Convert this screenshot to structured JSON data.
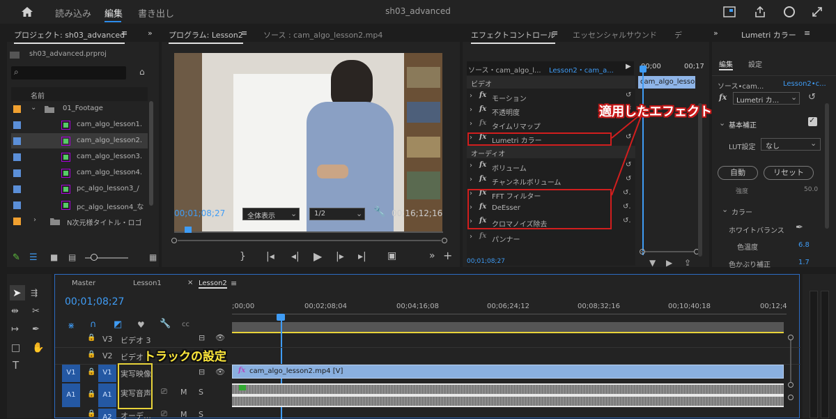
{
  "top": {
    "tabs": [
      "読み込み",
      "編集",
      "書き出し"
    ],
    "active_tab": "編集",
    "title": "sh03_advanced"
  },
  "project": {
    "tab": "プロジェクト: sh03_advanced",
    "file": "sh03_advanced.prproj",
    "search_placeholder": "",
    "col_name": "名前",
    "items": [
      {
        "label": "01_Footage",
        "color": "#f0a030",
        "kind": "folder"
      },
      {
        "label": "cam_algo_lesson1.",
        "color": "#5b8fd8",
        "kind": "clip"
      },
      {
        "label": "cam_algo_lesson2.",
        "color": "#5b8fd8",
        "kind": "clip"
      },
      {
        "label": "cam_algo_lesson3.",
        "color": "#5b8fd8",
        "kind": "clip"
      },
      {
        "label": "cam_algo_lesson4.",
        "color": "#5b8fd8",
        "kind": "clip"
      },
      {
        "label": "pc_algo_lesson3_/",
        "color": "#5b8fd8",
        "kind": "clip"
      },
      {
        "label": "pc_algo_lesson4_な",
        "color": "#5b8fd8",
        "kind": "clip"
      },
      {
        "label": "N次元様タイトル・ロゴ",
        "color": "#f0a030",
        "kind": "folder"
      }
    ]
  },
  "program": {
    "tab": "プログラム: Lesson2",
    "source_tab": "ソース : cam_algo_lesson2.mp4",
    "timecode": "00;01;08;27",
    "fit": "全体表示",
    "quality": "1/2",
    "duration": "00;16;12;16"
  },
  "effects": {
    "tab": "エフェクトコントロール",
    "tab2": "エッセンシャルサウンド",
    "tab3": "デ",
    "source": "ソース・cam_algo_l...",
    "target": "Lesson2・cam_a...",
    "time_start": "00;00",
    "time_end": "00;17",
    "clip_label": "cam_algo_lesso",
    "video_header": "ビデオ",
    "audio_header": "オーディオ",
    "video": [
      "モーション",
      "不透明度",
      "タイムリマップ",
      "Lumetri カラー"
    ],
    "audio": [
      "ボリューム",
      "チャンネルボリューム",
      "FFT フィルター",
      "DeEsser",
      "クロマノイズ除去",
      "パンナー"
    ],
    "timecode": "00;01;08;27",
    "callout": "適用したエフェクト"
  },
  "lumetri": {
    "tab": "Lumetri カラー",
    "sub_tabs": [
      "編集",
      "設定"
    ],
    "source": "ソース•cam...",
    "target": "Lesson2•c...",
    "fx_label": "Lumetri カ...",
    "basic": "基本補正",
    "lut_label": "LUT設定",
    "lut_value": "なし",
    "auto": "自動",
    "reset": "リセット",
    "intensity_label": "強度",
    "intensity_value": "50.0",
    "color_section": "カラー",
    "wb": "ホワイトバランス",
    "temp_label": "色温度",
    "temp_value": "6.8",
    "tint_label": "色かぶり補正",
    "tint_value": "1.7"
  },
  "timeline": {
    "tabs": [
      "Master",
      "Lesson1",
      "Lesson2"
    ],
    "timecode": "00;01;08;27",
    "ruler": [
      ";00;00",
      "00;02;08;04",
      "00;04;16;08",
      "00;06;24;12",
      "00;08;32;16",
      "00;10;40;18",
      "00;12;4"
    ],
    "v3": "V3",
    "v3_name": "ビデオ 3",
    "v2": "V2",
    "v2_name": "ビデオ 2",
    "v1": "V1",
    "v1_name": "実写映像",
    "a1": "A1",
    "a1_name": "実写音声",
    "a2": "A2",
    "a2_name": "オーデ…",
    "m": "M",
    "s": "S",
    "clip_v": "cam_algo_lesson2.mp4 [V]",
    "callout": "トラックの設定"
  }
}
